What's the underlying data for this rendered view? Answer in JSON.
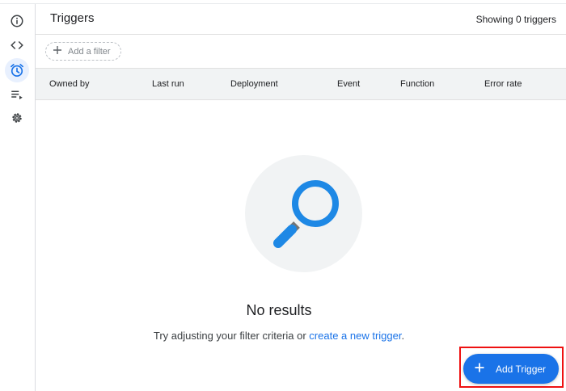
{
  "rail": {
    "items": [
      {
        "icon": "info-icon",
        "active": false
      },
      {
        "icon": "code-icon",
        "active": false
      },
      {
        "icon": "alarm-clock-icon",
        "active": true
      },
      {
        "icon": "playlist-play-icon",
        "active": false
      },
      {
        "icon": "gear-icon",
        "active": false
      }
    ]
  },
  "header": {
    "title": "Triggers",
    "count_text": "Showing 0 triggers"
  },
  "filter": {
    "label": "Add a filter"
  },
  "table": {
    "columns": [
      "Owned by",
      "Last run",
      "Deployment",
      "Event",
      "Function",
      "Error rate"
    ]
  },
  "empty_state": {
    "title": "No results",
    "message_prefix": "Try adjusting your filter criteria or ",
    "link_text": "create a new trigger",
    "message_suffix": "."
  },
  "fab": {
    "label": "Add Trigger"
  },
  "colors": {
    "accent": "#1a73e8",
    "active_rail_bg": "#e8f0fe",
    "highlight": "#ee1111",
    "magnifier": "#1e88e5"
  }
}
